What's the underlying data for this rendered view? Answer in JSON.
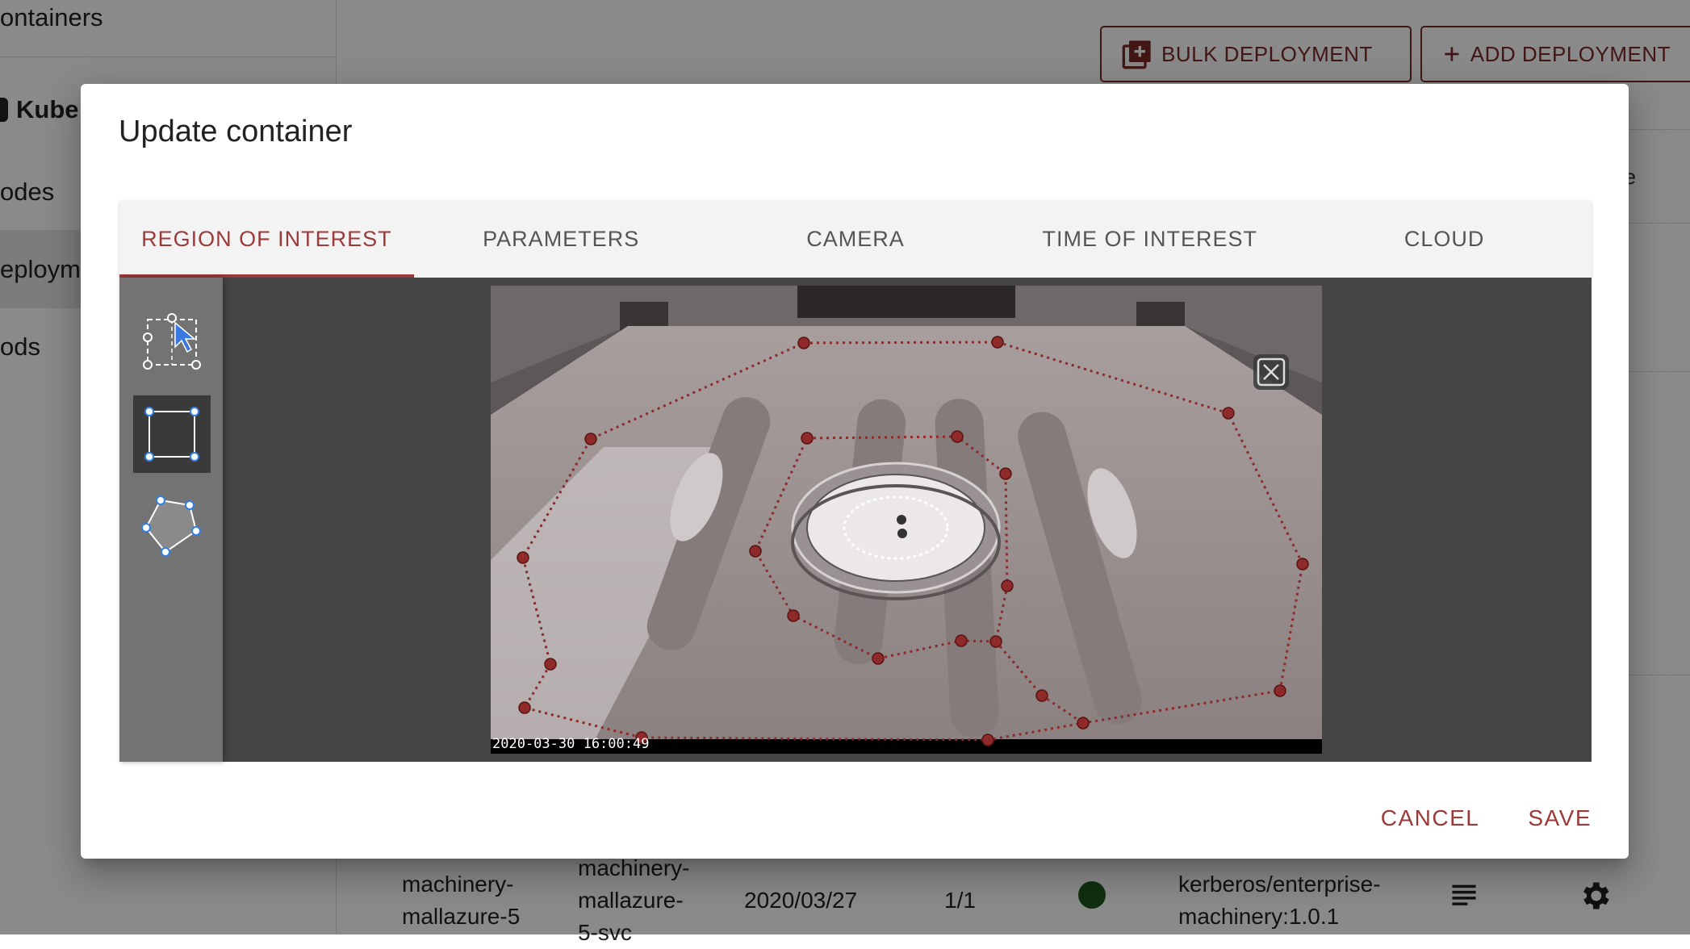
{
  "background": {
    "sidebar": {
      "items": [
        "ontainers",
        "Kube",
        "odes",
        "eployme",
        "ods"
      ]
    },
    "header_buttons": {
      "bulk": "BULK DEPLOYMENT",
      "add": "ADD DEPLOYMENT"
    },
    "peek_text": "re",
    "table_row": {
      "name": "machinery-\nmallazure-5",
      "service": "machinery-\nmallazure-\n5-svc",
      "date": "2020/03/27",
      "replicas": "1/1",
      "status_color": "#1e5a1e",
      "image": "kerberos/enterprise-\nmachinery:1.0.1"
    },
    "icons": [
      "add-box-icon",
      "plus-icon",
      "logs-icon",
      "gear-icon",
      "kubernetes-icon"
    ]
  },
  "dialog": {
    "title": "Update container",
    "tabs": [
      {
        "label": "REGION OF INTEREST",
        "active": true
      },
      {
        "label": "PARAMETERS",
        "active": false
      },
      {
        "label": "CAMERA",
        "active": false
      },
      {
        "label": "TIME OF INTEREST",
        "active": false
      },
      {
        "label": "CLOUD",
        "active": false
      }
    ],
    "tools": [
      {
        "name": "select-tool-icon",
        "selected": false
      },
      {
        "name": "rectangle-tool-icon",
        "selected": true
      },
      {
        "name": "polygon-tool-icon",
        "selected": false
      }
    ],
    "camera": {
      "timestamp": "2020-03-30 16:00:49"
    },
    "actions": {
      "cancel": "CANCEL",
      "save": "SAVE"
    },
    "colors": {
      "accent": "#9c3a3a",
      "polygon": "#8e2a2a"
    }
  }
}
